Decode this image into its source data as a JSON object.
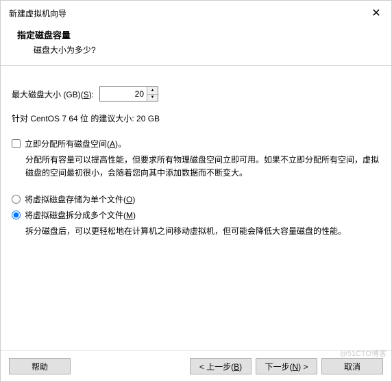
{
  "titlebar": {
    "title": "新建虚拟机向导"
  },
  "header": {
    "title": "指定磁盘容量",
    "subtitle": "磁盘大小为多少?"
  },
  "disk_size": {
    "label_prefix": "最大磁盘大小 (GB)(",
    "label_suffix": "):",
    "accelerator": "S",
    "value": "20"
  },
  "recommended": "针对 CentOS 7 64 位 的建议大小: 20 GB",
  "allocate": {
    "label_prefix": "立即分配所有磁盘空间(",
    "label_suffix": ")。",
    "accelerator": "A",
    "description": "分配所有容量可以提高性能，但要求所有物理磁盘空间立即可用。如果不立即分配所有空间，虚拟磁盘的空间最初很小，会随着您向其中添加数据而不断变大。"
  },
  "storage": {
    "single": {
      "label_prefix": "将虚拟磁盘存储为单个文件(",
      "label_suffix": ")",
      "accelerator": "O"
    },
    "split": {
      "label_prefix": "将虚拟磁盘拆分成多个文件(",
      "label_suffix": ")",
      "accelerator": "M",
      "description": "拆分磁盘后，可以更轻松地在计算机之间移动虚拟机，但可能会降低大容量磁盘的性能。"
    }
  },
  "footer": {
    "help": "帮助",
    "back": "< 上一步(",
    "back_accel": "B",
    "back_suffix": ")",
    "next": "下一步(",
    "next_accel": "N",
    "next_suffix": ") >",
    "cancel": "取消"
  },
  "watermark": "@51CTO博客"
}
